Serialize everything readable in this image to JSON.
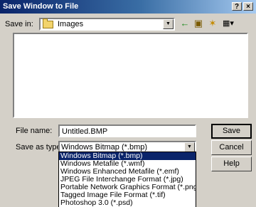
{
  "window": {
    "title": "Save Window to File",
    "help_button": "?",
    "close_button": "×"
  },
  "save_in": {
    "label": "Save in:",
    "value": "Images",
    "dropdown_icon": "down-arrow-icon"
  },
  "toolbar": {
    "back_icon": "←",
    "up_folder_icon": "▣",
    "new_folder_icon": "✶",
    "view_menu_icon": "▦▾"
  },
  "file_name": {
    "label": "File name:",
    "value": "Untitled.BMP"
  },
  "save_as_type": {
    "label": "Save as type:",
    "value": "Windows Bitmap (*.bmp)",
    "options": [
      "Windows Bitmap (*.bmp)",
      "Windows Metafile (*.wmf)",
      "Windows Enhanced Metafile (*.emf)",
      "JPEG File Interchange Format (*.jpg)",
      "Portable Network Graphics Format (*.png)",
      "Tagged Image File Format (*.tif)",
      "Photoshop 3.0 (*.psd)"
    ],
    "selected_index": 0
  },
  "buttons": {
    "save": "Save",
    "cancel": "Cancel",
    "help": "Help"
  },
  "colors": {
    "title_start": "#0a246a",
    "title_end": "#a6caf0",
    "face": "#d4d0c8",
    "selection": "#0a246a"
  }
}
